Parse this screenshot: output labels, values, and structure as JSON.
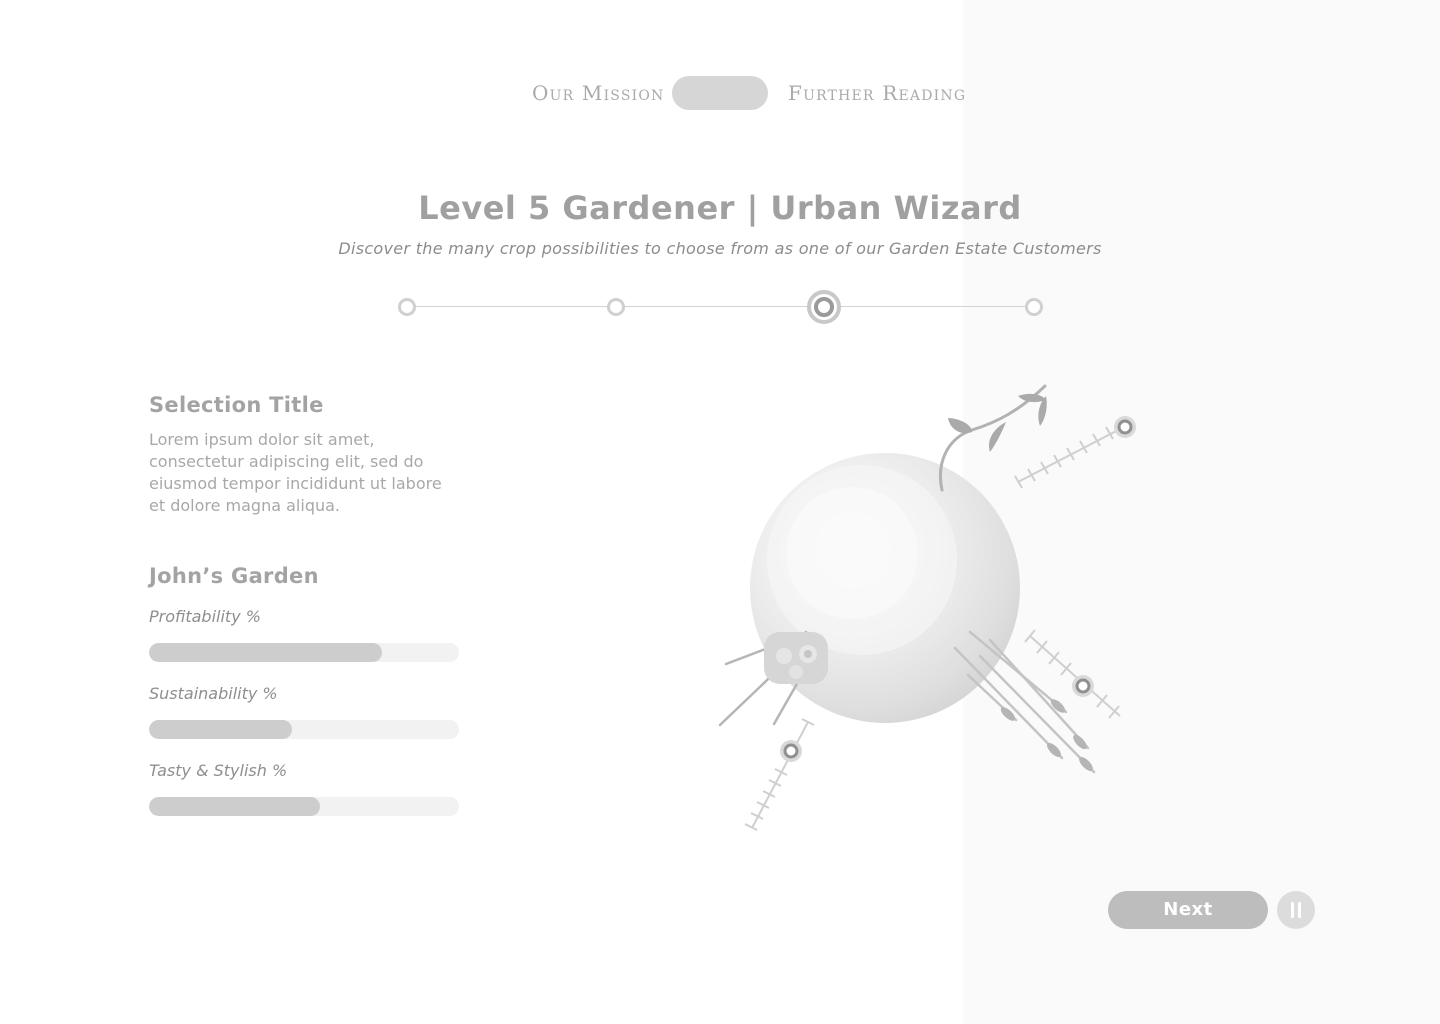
{
  "nav": {
    "left_label": "Our Mission",
    "right_label": "Further Reading"
  },
  "header": {
    "title": "Level 5 Gardener | Urban Wizard",
    "subtitle": "Discover the many crop possibilities to choose from as one of our Garden Estate Customers"
  },
  "stepper": {
    "total_steps": 4,
    "current_step": 3
  },
  "selection": {
    "title": "Selection Title",
    "body": "Lorem ipsum dolor sit amet, consectetur adipiscing elit, sed do eiusmod tempor incididunt ut labore et dolore magna aliqua."
  },
  "garden": {
    "title": "John’s Garden",
    "metrics": [
      {
        "label": "Profitability %",
        "percent": 75
      },
      {
        "label": "Sustainability %",
        "percent": 46
      },
      {
        "label": "Tasty & Stylish %",
        "percent": 55
      }
    ]
  },
  "actions": {
    "next_label": "Next",
    "pause_icon": "pause-icon"
  },
  "colors": {
    "right_panel_bg": "#fafafa",
    "bar_fill": "#cdcdcd",
    "bar_track": "#f2f2f2",
    "next_button": "#bdbdbd"
  }
}
